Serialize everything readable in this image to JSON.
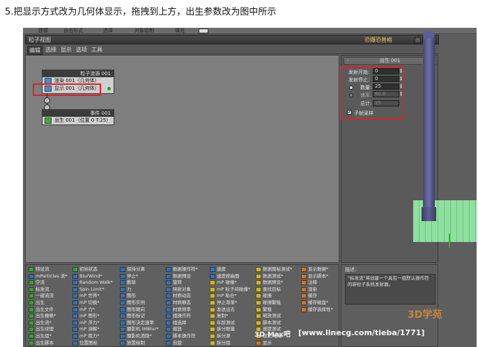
{
  "caption": "5.把显示方式改为几何体显示，拖拽到上方，出生参数改为图中所示",
  "app": {
    "top_menu": [
      "建模",
      "自由形式",
      "选择",
      "对象绘制",
      "填充"
    ],
    "window_title": "粒子视图",
    "window_buttons": [
      "-",
      "□",
      "×"
    ],
    "menu": [
      "编辑",
      "选择",
      "显示",
      "选项",
      "工具"
    ],
    "toolbar_right": "恐爆恐兽格"
  },
  "nodes": {
    "system": {
      "title": "粒子流源 001",
      "rows": [
        "渲染 001（几何体）",
        "显示 001（几何体）"
      ]
    },
    "event": {
      "title": "事件 001",
      "rows": [
        "出生 001（位置 0 T:25）"
      ]
    }
  },
  "birth_panel": {
    "title": "出生 001",
    "emit_start_label": "发射开始:",
    "emit_start": "0",
    "emit_stop_label": "发射停止:",
    "emit_stop": "0",
    "amount_label": "数量:",
    "amount": "25",
    "rate_label": "速率:",
    "rate": "60.0",
    "total_label": "总计:",
    "total": "25",
    "subframe_label": "子帧采样"
  },
  "depot": {
    "columns": [
      [
        {
          "t": "特设流",
          "c": "g"
        },
        {
          "t": "mParticles 流*",
          "c": "b"
        },
        {
          "t": "空流",
          "c": "g"
        },
        {
          "t": "标准流",
          "c": "g"
        },
        {
          "t": "一键流流",
          "c": "g"
        },
        {
          "t": "出生",
          "c": "g"
        },
        {
          "t": "出生文件",
          "c": "g"
        },
        {
          "t": "出生栅格*",
          "c": "g"
        },
        {
          "t": "出生流*",
          "c": "g"
        },
        {
          "t": "出生纹理",
          "c": "g"
        },
        {
          "t": "出生组*",
          "c": "g"
        },
        {
          "t": "出生脚本",
          "c": "g"
        }
      ],
      [
        {
          "t": "初始状态",
          "c": "g"
        },
        {
          "t": "BlurWind*",
          "c": "b"
        },
        {
          "t": "Random Walk*",
          "c": "b"
        },
        {
          "t": "Spin Limit*",
          "c": "b"
        },
        {
          "t": "mP 世界*",
          "c": "b"
        },
        {
          "t": "mP 切换*",
          "c": "b"
        },
        {
          "t": "mP 力*",
          "c": "b"
        },
        {
          "t": "mP 图形*",
          "c": "b"
        },
        {
          "t": "mP 浮力*",
          "c": "b"
        },
        {
          "t": "mP 溶解*",
          "c": "b"
        },
        {
          "t": "mP 阻力*",
          "c": "b"
        },
        {
          "t": "位置图标",
          "c": "b"
        }
      ],
      [
        {
          "t": "保持分离",
          "c": "b"
        },
        {
          "t": "停止*",
          "c": "b"
        },
        {
          "t": "删除",
          "c": "b"
        },
        {
          "t": "力",
          "c": "b"
        },
        {
          "t": "图形",
          "c": "b"
        },
        {
          "t": "图形实例",
          "c": "b"
        },
        {
          "t": "图形朝向",
          "c": "b"
        },
        {
          "t": "图形标记",
          "c": "b"
        },
        {
          "t": "图形决定速率",
          "c": "b"
        },
        {
          "t": "摄影机 IMBlur*",
          "c": "b"
        },
        {
          "t": "摄影机消隐*",
          "c": "b"
        },
        {
          "t": "放置绘制",
          "c": "b"
        }
      ],
      [
        {
          "t": "数据操作符*",
          "c": "b"
        },
        {
          "t": "数据预设",
          "c": "b"
        },
        {
          "t": "旋转",
          "c": "b"
        },
        {
          "t": "映射对象",
          "c": "b"
        },
        {
          "t": "材质动态",
          "c": "b"
        },
        {
          "t": "材质静态",
          "c": "b"
        },
        {
          "t": "材质频率",
          "c": "b"
        },
        {
          "t": "组操作符",
          "c": "b"
        },
        {
          "t": "组选择",
          "c": "b"
        },
        {
          "t": "缩放",
          "c": "b"
        },
        {
          "t": "脚本操作符",
          "c": "b"
        },
        {
          "t": "自旋",
          "c": "b"
        }
      ],
      [
        {
          "t": "速度",
          "c": "b"
        },
        {
          "t": "速度按曲面",
          "c": "b"
        },
        {
          "t": "mP 碰撞*",
          "c": "y"
        },
        {
          "t": "mP 粒子间碰撞*",
          "c": "y"
        },
        {
          "t": "mP 粘合*",
          "c": "y"
        },
        {
          "t": "停止渐渐*",
          "c": "y"
        },
        {
          "t": "发送出去",
          "c": "y"
        },
        {
          "t": "复制*",
          "c": "y"
        },
        {
          "t": "年龄测试",
          "c": "y"
        },
        {
          "t": "拆分数量",
          "c": "y"
        },
        {
          "t": "拆分源",
          "c": "y"
        },
        {
          "t": "拆分组",
          "c": "y"
        }
      ],
      [
        {
          "t": "数据图标测试*",
          "c": "y"
        },
        {
          "t": "数据测试*",
          "c": "y"
        },
        {
          "t": "数据预设*",
          "c": "y"
        },
        {
          "t": "查找目标",
          "c": "y"
        },
        {
          "t": "碰撞",
          "c": "y"
        },
        {
          "t": "碰撞繁殖",
          "c": "y"
        },
        {
          "t": "繁殖",
          "c": "y"
        },
        {
          "t": "缩放测试",
          "c": "y"
        },
        {
          "t": "脚本测试",
          "c": "y"
        },
        {
          "t": "速度测试",
          "c": "y"
        },
        {
          "t": "锁定/粘着",
          "c": "y"
        },
        {
          "t": "显示",
          "c": "o"
        }
      ],
      [
        {
          "t": "显示数据*",
          "c": "o"
        },
        {
          "t": "显示脚本*",
          "c": "o"
        },
        {
          "t": "注释",
          "c": "o"
        },
        {
          "t": "渲染",
          "c": "o"
        },
        {
          "t": "缓存",
          "c": "o"
        },
        {
          "t": "缓存磁盘*",
          "c": "o"
        },
        {
          "t": "缓存选择性*",
          "c": "o"
        }
      ]
    ]
  },
  "description": {
    "label": "描述:",
    "text": "\"标准流\"将创建一个具有一组默认操作符的新粒子系统发射器。"
  },
  "watermark": "[www.linecg.com/tieba/1771]",
  "watermark_left": "3D Max吧",
  "watermark_logo": "3D学苑"
}
